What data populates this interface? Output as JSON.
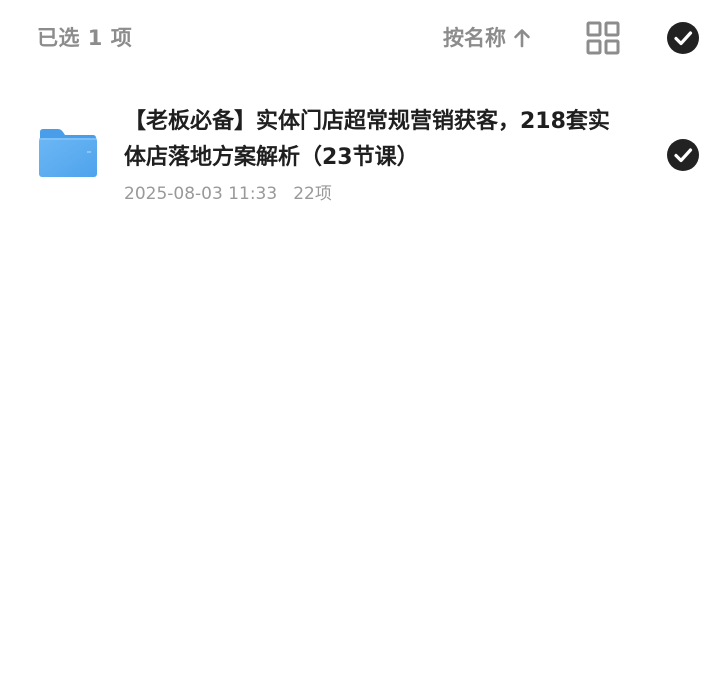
{
  "header": {
    "selected_text": "已选 1 项",
    "sort_label": "按名称",
    "sort_icon": "arrow-up-icon",
    "view_icon": "grid-view-icon",
    "select_all_icon": "check-circle-icon"
  },
  "files": [
    {
      "icon": "folder-icon",
      "name": "【老板必备】实体门店超常规营销获客，218套实体店落地方案解析（23节课）",
      "date": "2025-08-03 11:33",
      "count": "22项",
      "selected": true
    }
  ],
  "colors": {
    "muted_text": "#8c8c8c",
    "meta_text": "#999999",
    "title_text": "#1f1f1f",
    "check_fill": "#222222",
    "folder_blue": "#5aaaf0"
  }
}
